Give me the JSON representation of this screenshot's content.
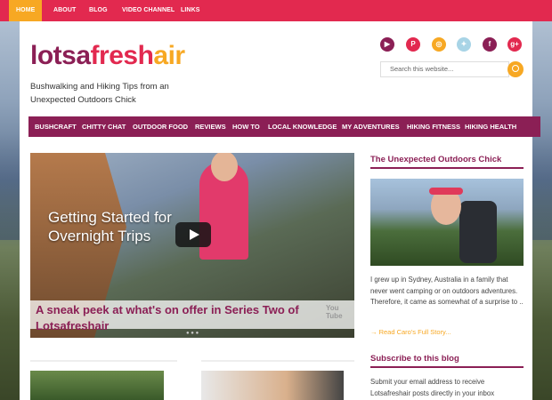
{
  "top_nav": [
    "HOME",
    "ABOUT",
    "BLOG",
    "VIDEO CHANNEL",
    "LINKS"
  ],
  "logo": {
    "part1": "lotsa",
    "part2": "fresh",
    "part3": "air"
  },
  "tagline": "Bushwalking and Hiking Tips from an Unexpected Outdoors Chick",
  "social": [
    {
      "icon": "youtube-icon",
      "glyph": "▶",
      "color": "#8b1f55"
    },
    {
      "icon": "pinterest-icon",
      "glyph": "P",
      "color": "#e2294f"
    },
    {
      "icon": "instagram-icon",
      "glyph": "◎",
      "color": "#f7a823"
    },
    {
      "icon": "twitter-icon",
      "glyph": "✦",
      "color": "#a8d4e6"
    },
    {
      "icon": "facebook-icon",
      "glyph": "f",
      "color": "#8b1f55"
    },
    {
      "icon": "googleplus-icon",
      "glyph": "g+",
      "color": "#e2294f"
    }
  ],
  "search_placeholder": "Search this website...",
  "main_nav": [
    "BUSHCRAFT",
    "CHITTY CHAT",
    "OUTDOOR FOOD",
    "REVIEWS",
    "HOW TO",
    "LOCAL KNOWLEDGE",
    "MY ADVENTURES",
    "HIKING FITNESS",
    "HIKING HEALTH"
  ],
  "video": {
    "overlay_title": "Getting Started for Overnight Trips",
    "caption": "A sneak peek at what's on offer in Series Two of Lotsafreshair",
    "watermark": "You Tube"
  },
  "sidebar": {
    "about_heading": "The Unexpected Outdoors Chick",
    "about_text": "I grew up in Sydney, Australia in a family that never went camping or on outdoors adventures. Therefore, it came as somewhat of a surprise to ..",
    "more_link": "→ Read Caro's Full Story...",
    "subscribe_heading": "Subscribe to this blog",
    "subscribe_text": "Submit your email address to receive Lotsafreshair posts directly in your inbox"
  },
  "colors": {
    "primary": "#8b1f55",
    "accent": "#e2294f",
    "orange": "#f7a823"
  }
}
